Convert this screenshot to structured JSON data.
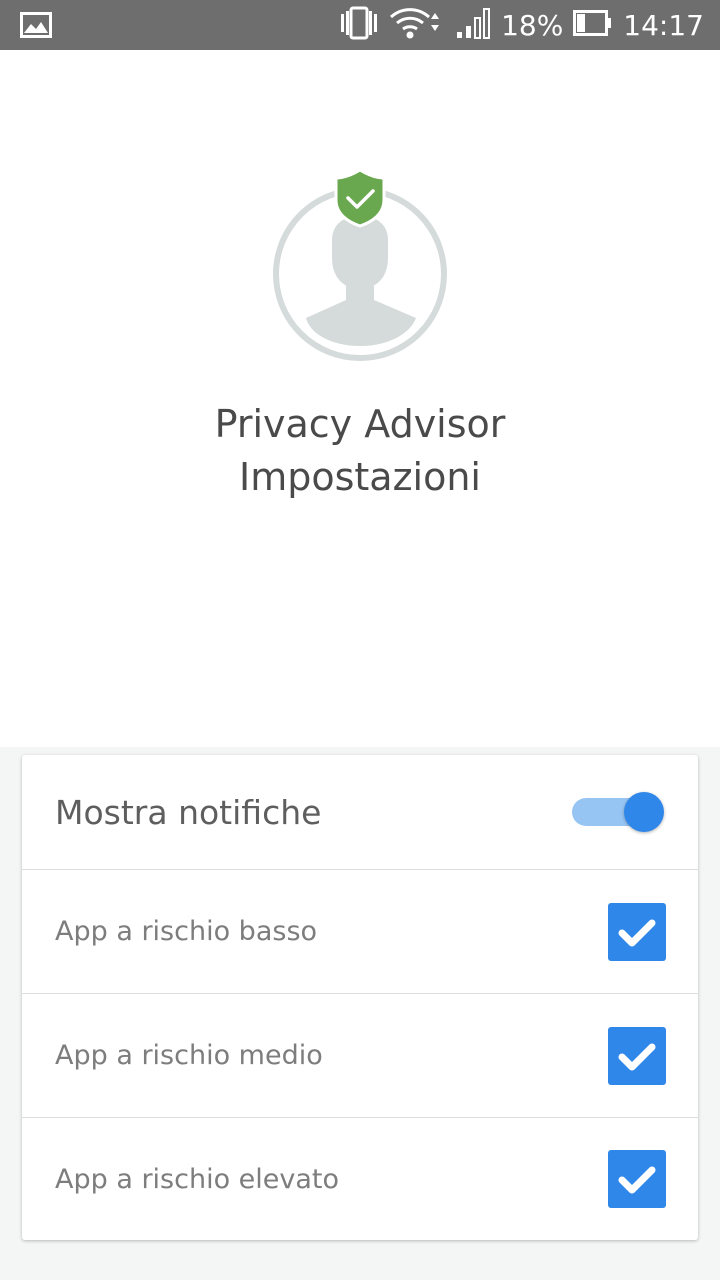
{
  "status_bar": {
    "left_icon": "gallery-icon",
    "battery_percent": "18%",
    "time": "14:17",
    "icons": [
      "vibrate-icon",
      "wifi-icon",
      "signal-icon",
      "battery-icon"
    ]
  },
  "hero": {
    "title_line1": "Privacy Advisor",
    "title_line2": "Impostazioni",
    "avatar_icon": "user-avatar-icon",
    "badge_icon": "shield-check-icon"
  },
  "settings": {
    "header_label": "Mostra notifiche",
    "header_toggle_on": true,
    "items": [
      {
        "label": "App a rischio basso",
        "checked": true
      },
      {
        "label": "App a rischio medio",
        "checked": true
      },
      {
        "label": "App a rischio elevato",
        "checked": true
      }
    ]
  },
  "colors": {
    "accent": "#2f87ea",
    "toggle_track": "#97c5f3",
    "shield_green": "#6aa84f",
    "status_bar": "#6e6e6e"
  }
}
